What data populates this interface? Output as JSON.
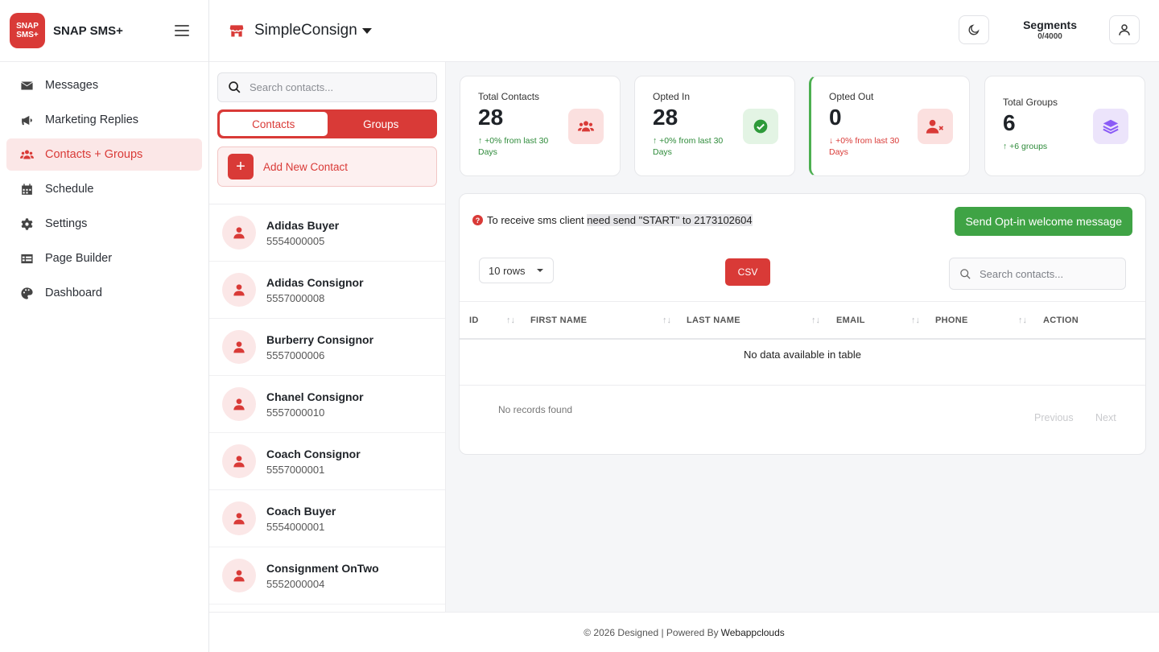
{
  "app": {
    "logo_top": "SNAP",
    "logo_bottom": "SMS+",
    "name": "SNAP SMS+"
  },
  "sidebar": {
    "items": [
      {
        "label": "Messages",
        "icon": "envelope-icon"
      },
      {
        "label": "Marketing Replies",
        "icon": "megaphone-icon"
      },
      {
        "label": "Contacts + Groups",
        "icon": "users-icon",
        "active": true
      },
      {
        "label": "Schedule",
        "icon": "calendar-icon"
      },
      {
        "label": "Settings",
        "icon": "gear-icon"
      },
      {
        "label": "Page Builder",
        "icon": "table-icon"
      },
      {
        "label": "Dashboard",
        "icon": "palette-icon"
      }
    ]
  },
  "header": {
    "store_name": "SimpleConsign",
    "segments_title": "Segments",
    "segments_value": "0/4000"
  },
  "contacts_panel": {
    "search_placeholder": "Search contacts...",
    "tab_contacts": "Contacts",
    "tab_groups": "Groups",
    "add_label": "Add New Contact",
    "contacts": [
      {
        "name": "Adidas Buyer",
        "phone": "5554000005"
      },
      {
        "name": "Adidas Consignor",
        "phone": "5557000008"
      },
      {
        "name": "Burberry Consignor",
        "phone": "5557000006"
      },
      {
        "name": "Chanel Consignor",
        "phone": "5557000010"
      },
      {
        "name": "Coach Consignor",
        "phone": "5557000001"
      },
      {
        "name": "Coach Buyer",
        "phone": "5554000001"
      },
      {
        "name": "Consignment OnTwo",
        "phone": "5552000004"
      }
    ]
  },
  "stats": [
    {
      "label": "Total Contacts",
      "value": "28",
      "delta": "↑ +0% from last 30 Days",
      "trend": "up"
    },
    {
      "label": "Opted In",
      "value": "28",
      "delta": "↑ +0% from last 30 Days",
      "trend": "up"
    },
    {
      "label": "Opted Out",
      "value": "0",
      "delta": "↓ +0% from last 30 Days",
      "trend": "down"
    },
    {
      "label": "Total Groups",
      "value": "6",
      "delta": "↑ +6 groups",
      "trend": "up"
    }
  ],
  "table_card": {
    "notice_before": "To receive sms client ",
    "notice_highlight": "need send \"START\" to 2173102604",
    "send_button": "Send Opt-in welcome message",
    "rows_select": "10 rows",
    "csv_button": "CSV",
    "search_placeholder": "Search contacts...",
    "columns": [
      "ID",
      "FIRST NAME",
      "LAST NAME",
      "EMAIL",
      "PHONE",
      "ACTION"
    ],
    "sort_glyph": "↑↓",
    "empty_message": "No data available in table",
    "records_text": "No records found",
    "prev_label": "Previous",
    "next_label": "Next"
  },
  "footer": {
    "text": "© 2026 Designed | Powered By",
    "brand": "Webappclouds"
  },
  "colors": {
    "accent": "#d93a37",
    "success": "#3fa345",
    "purple": "#8b5cf6"
  }
}
